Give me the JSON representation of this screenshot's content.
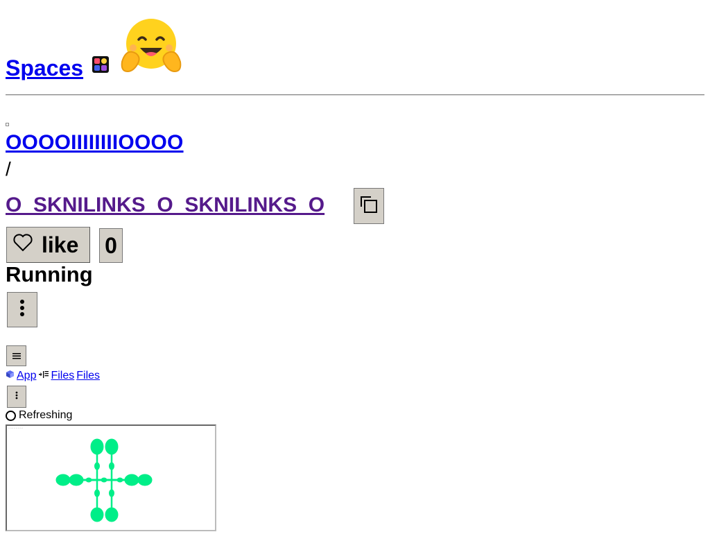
{
  "header": {
    "spaces_label": "Spaces",
    "spaces_icon": "spaces-grid-icon",
    "logo_icon": "hugging-face-emoji-icon"
  },
  "repo": {
    "owner": "OOOOIIIIIIIIOOOO",
    "separator": "/",
    "name": "O_SKNILINKS_O_SKNILINKS_O",
    "copy_icon": "copy-icon"
  },
  "like": {
    "label": "like",
    "count": "0",
    "icon": "heart-outline-icon"
  },
  "status": "Running",
  "tabs": [
    {
      "label": "App",
      "icon": "cube-icon"
    },
    {
      "label": "Files",
      "icon": "files-list-icon"
    },
    {
      "label": "Files"
    }
  ],
  "refresh_label": "Refreshing",
  "colors": {
    "link": "#0000ee",
    "visited_link": "#551a8b",
    "button_bg": "#d4d0c8",
    "preview_glyph": "#00ee88"
  }
}
